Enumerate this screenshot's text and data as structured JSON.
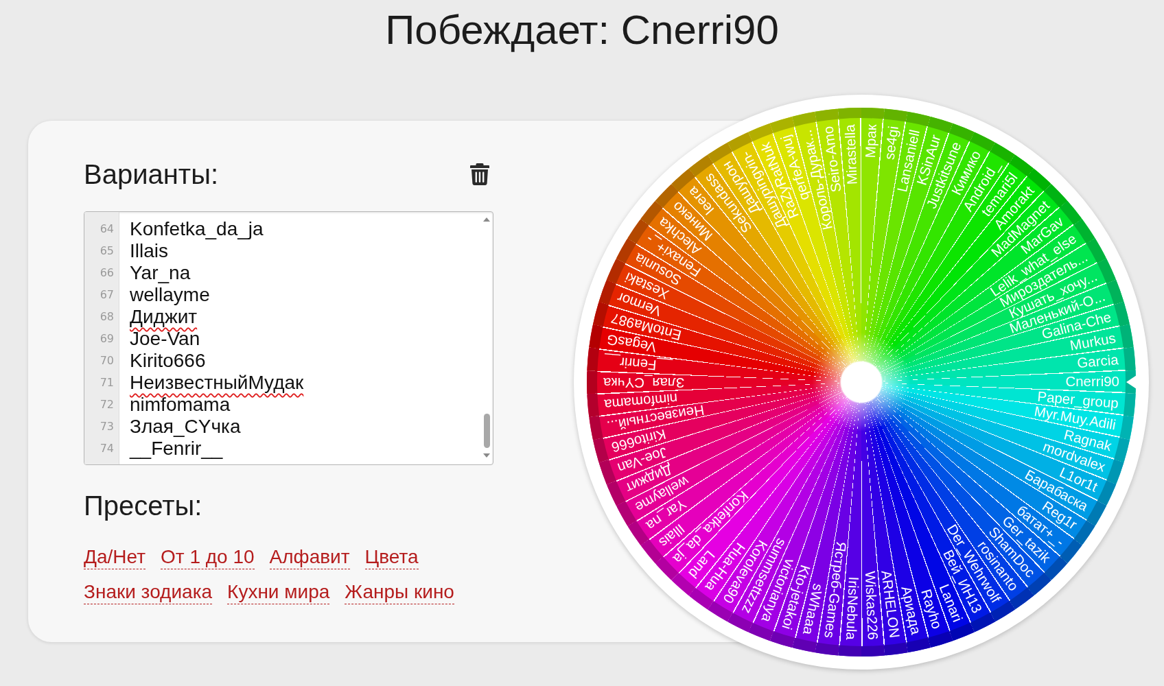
{
  "title": "Побеждает: Cnerri90",
  "options": {
    "heading": "Варианты:",
    "lines": [
      {
        "number": "64",
        "text": "Konfetka_da_ja",
        "misspelled": false
      },
      {
        "number": "65",
        "text": "Illais",
        "misspelled": false
      },
      {
        "number": "66",
        "text": "Yar_na",
        "misspelled": false
      },
      {
        "number": "67",
        "text": "wellayme",
        "misspelled": false
      },
      {
        "number": "68",
        "text": "Диджит",
        "misspelled": true
      },
      {
        "number": "69",
        "text": "Joe-Van",
        "misspelled": false
      },
      {
        "number": "70",
        "text": "Kirito666",
        "misspelled": false
      },
      {
        "number": "71",
        "text": "НеизвестныйМудак",
        "misspelled": true
      },
      {
        "number": "72",
        "text": "nimfomama",
        "misspelled": false
      },
      {
        "number": "73",
        "text": "Злая_СYчка",
        "misspelled": false
      },
      {
        "number": "74",
        "text": "__Fenrir__",
        "misspelled": false
      }
    ]
  },
  "presets": {
    "heading": "Пресеты:",
    "links": [
      "Да/Нет",
      "От 1 до 10",
      "Алфавит",
      "Цвета",
      "Знаки зодиака",
      "Кухни мира",
      "Жанры кино"
    ]
  },
  "wheel": {
    "segments": [
      {
        "label": "Cnerri90",
        "color": "#00b396"
      },
      {
        "label": "Paper_group",
        "color": "#00b3a4"
      },
      {
        "label": "Myr.Muy.Adili",
        "color": "#00b3b3"
      },
      {
        "label": "Ragnak",
        "color": "#00a5b3"
      },
      {
        "label": "mordvalex",
        "color": "#0097b3"
      },
      {
        "label": "L1or1t",
        "color": "#0089b3"
      },
      {
        "label": "Барабаска",
        "color": "#007ab3"
      },
      {
        "label": "Reg1r",
        "color": "#006cb3"
      },
      {
        "label": "батат+_-",
        "color": "#005db3"
      },
      {
        "label": "Ger_tazik",
        "color": "#004eb3"
      },
      {
        "label": "ShamDoc",
        "color": "#0040b3"
      },
      {
        "label": "rosinanto",
        "color": "#0031b3"
      },
      {
        "label": "Der_Wehrwolf",
        "color": "#0022b3"
      },
      {
        "label": "Вей_ИН13",
        "color": "#0014b3"
      },
      {
        "label": "Lanari",
        "color": "#0005b3"
      },
      {
        "label": "Rayho",
        "color": "#0900b3"
      },
      {
        "label": "Ариада",
        "color": "#1700b3"
      },
      {
        "label": "ARHELON",
        "color": "#2600b3"
      },
      {
        "label": "Wiskas226",
        "color": "#3400b3"
      },
      {
        "label": "IrisNebula",
        "color": "#4300b3"
      },
      {
        "label": "Ястреб-Games",
        "color": "#5200b3"
      },
      {
        "label": "sWhaaa",
        "color": "#6000b3"
      },
      {
        "label": "Kto-jetakoi",
        "color": "#6f00b3"
      },
      {
        "label": "victorianya",
        "color": "#7e00b3"
      },
      {
        "label": "summsettzzz",
        "color": "#8c00b3"
      },
      {
        "label": "Koroleva90",
        "color": "#9a00b3"
      },
      {
        "label": "Hua-Hua",
        "color": "#a900b3"
      },
      {
        "label": "Land",
        "color": "#b300b0"
      },
      {
        "label": "Konfetka_da_ja",
        "color": "#b300a1"
      },
      {
        "label": "Illais",
        "color": "#b30093"
      },
      {
        "label": "Yar_na",
        "color": "#b30084"
      },
      {
        "label": "wellayme",
        "color": "#b30075"
      },
      {
        "label": "Диджит",
        "color": "#b30067"
      },
      {
        "label": "Joe-Van",
        "color": "#b30058"
      },
      {
        "label": "Kirito666",
        "color": "#b30049"
      },
      {
        "label": "Неизвестный...",
        "color": "#b3003b"
      },
      {
        "label": "nimfomama",
        "color": "#b3002c"
      },
      {
        "label": "Злая_СYчка",
        "color": "#b3001e"
      },
      {
        "label": "__Fenrir__",
        "color": "#b30010"
      },
      {
        "label": "VegasG",
        "color": "#b30001"
      },
      {
        "label": "EntoMa987",
        "color": "#b30e00"
      },
      {
        "label": "Vermor",
        "color": "#b31c00"
      },
      {
        "label": "Xestaki",
        "color": "#b32b00"
      },
      {
        "label": "Sosunia",
        "color": "#b33a00"
      },
      {
        "label": "Fenaxi+_-",
        "color": "#b34800"
      },
      {
        "label": "Alechka",
        "color": "#b35700"
      },
      {
        "label": "Минеко",
        "color": "#b36500"
      },
      {
        "label": "leera",
        "color": "#b37300"
      },
      {
        "label": "Sekundass",
        "color": "#b38200"
      },
      {
        "label": "Дашурон",
        "color": "#b39100"
      },
      {
        "label": "Дашуpingvin-",
        "color": "#b39f00"
      },
      {
        "label": "RaZyRatNuk",
        "color": "#b3ae00"
      },
      {
        "label": "qerfeA-wuj",
        "color": "#abb300"
      },
      {
        "label": "Король-Дурак...",
        "color": "#9cb300"
      },
      {
        "label": "Seiro-Amo",
        "color": "#8db300"
      },
      {
        "label": "Mirastella",
        "color": "#7fb300"
      },
      {
        "label": "Мрак",
        "color": "#70b300"
      },
      {
        "label": "se4gi",
        "color": "#62b300"
      },
      {
        "label": "Lansaniell",
        "color": "#53b300"
      },
      {
        "label": "KSinAur",
        "color": "#45b300"
      },
      {
        "label": "Justkitsune",
        "color": "#36b300"
      },
      {
        "label": "Кимико",
        "color": "#28b300"
      },
      {
        "label": "Android_",
        "color": "#19b300"
      },
      {
        "label": "temari5l",
        "color": "#0ab300"
      },
      {
        "label": "Amorakt",
        "color": "#00b304"
      },
      {
        "label": "MadMagnet",
        "color": "#00b313"
      },
      {
        "label": "MarGav",
        "color": "#00b321"
      },
      {
        "label": "Lelik_what_else",
        "color": "#00b330"
      },
      {
        "label": "Мироздатель...",
        "color": "#00b33e"
      },
      {
        "label": "Кушать_хочу...",
        "color": "#00b34c"
      },
      {
        "label": "Маленький-О...",
        "color": "#00b35b"
      },
      {
        "label": "Galina-Che",
        "color": "#00b36a"
      },
      {
        "label": "Murkus",
        "color": "#00b378"
      },
      {
        "label": "Garcia",
        "color": "#00b387"
      }
    ]
  }
}
